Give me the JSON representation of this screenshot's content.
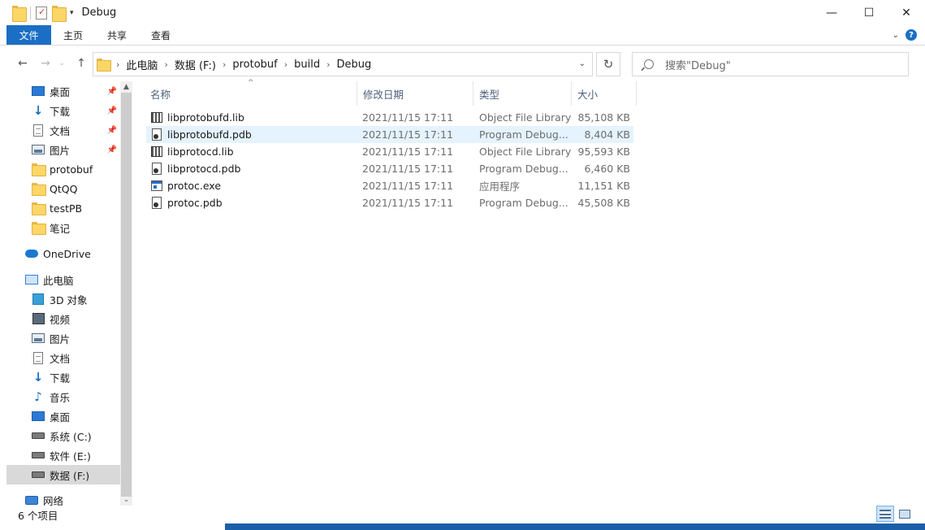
{
  "window": {
    "title": "Debug",
    "minimize_glyph": "—",
    "maximize_glyph": "☐",
    "close_glyph": "✕"
  },
  "ribbon": {
    "tabs": [
      "文件",
      "主页",
      "共享",
      "查看"
    ]
  },
  "address": {
    "crumbs": [
      "此电脑",
      "数据 (F:)",
      "protobuf",
      "build",
      "Debug"
    ],
    "search_placeholder": "搜索\"Debug\""
  },
  "sidebar": {
    "items": [
      {
        "label": "桌面",
        "icon": "desktop-icon",
        "pinned": true
      },
      {
        "label": "下载",
        "icon": "download-icon",
        "pinned": true
      },
      {
        "label": "文档",
        "icon": "document-icon",
        "pinned": true
      },
      {
        "label": "图片",
        "icon": "pictures-icon",
        "pinned": true
      },
      {
        "label": "protobuf",
        "icon": "folder-icon",
        "pinned": false
      },
      {
        "label": "QtQQ",
        "icon": "folder-icon",
        "pinned": false
      },
      {
        "label": "testPB",
        "icon": "folder-icon",
        "pinned": false
      },
      {
        "label": "笔记",
        "icon": "folder-icon",
        "pinned": false
      },
      {
        "label": "OneDrive",
        "icon": "onedrive-icon",
        "pinned": false
      },
      {
        "label": "此电脑",
        "icon": "this-pc-icon",
        "pinned": false
      },
      {
        "label": "3D 对象",
        "icon": "3d-objects-icon",
        "pinned": false
      },
      {
        "label": "视频",
        "icon": "videos-icon",
        "pinned": false
      },
      {
        "label": "图片",
        "icon": "pictures-icon",
        "pinned": false
      },
      {
        "label": "文档",
        "icon": "document-icon",
        "pinned": false
      },
      {
        "label": "下载",
        "icon": "download-icon",
        "pinned": false
      },
      {
        "label": "音乐",
        "icon": "music-icon",
        "pinned": false
      },
      {
        "label": "桌面",
        "icon": "desktop-icon",
        "pinned": false
      },
      {
        "label": "系统 (C:)",
        "icon": "drive-icon",
        "pinned": false
      },
      {
        "label": "软件 (E:)",
        "icon": "drive-icon",
        "pinned": false
      },
      {
        "label": "数据 (F:)",
        "icon": "drive-icon",
        "pinned": false,
        "selected": true
      },
      {
        "label": "网络",
        "icon": "network-icon",
        "pinned": false
      }
    ]
  },
  "columns": {
    "name": "名称",
    "date": "修改日期",
    "type": "类型",
    "size": "大小"
  },
  "files": [
    {
      "name": "libprotobufd.lib",
      "date": "2021/11/15 17:11",
      "type": "Object File Library",
      "size": "85,108 KB",
      "icon": "lib-file-icon"
    },
    {
      "name": "libprotobufd.pdb",
      "date": "2021/11/15 17:11",
      "type": "Program Debug...",
      "size": "8,404 KB",
      "icon": "pdb-file-icon",
      "hover": true
    },
    {
      "name": "libprotocd.lib",
      "date": "2021/11/15 17:11",
      "type": "Object File Library",
      "size": "95,593 KB",
      "icon": "lib-file-icon"
    },
    {
      "name": "libprotocd.pdb",
      "date": "2021/11/15 17:11",
      "type": "Program Debug...",
      "size": "6,460 KB",
      "icon": "pdb-file-icon"
    },
    {
      "name": "protoc.exe",
      "date": "2021/11/15 17:11",
      "type": "应用程序",
      "size": "11,151 KB",
      "icon": "exe-file-icon"
    },
    {
      "name": "protoc.pdb",
      "date": "2021/11/15 17:11",
      "type": "Program Debug...",
      "size": "45,508 KB",
      "icon": "pdb-file-icon"
    }
  ],
  "status": {
    "item_count": "6 个项目"
  }
}
